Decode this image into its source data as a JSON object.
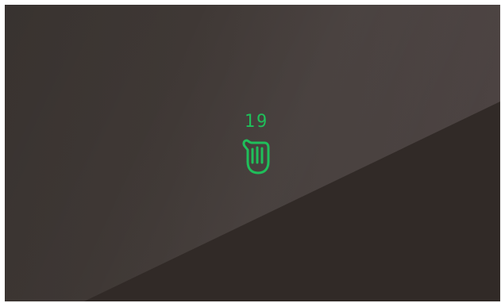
{
  "screen": {
    "counter_value": "19",
    "icon": "raised-hand-icon",
    "accent_color": "#1fbf5a",
    "background_color": "#3f3835",
    "lower_panel_color": "#312a27"
  }
}
